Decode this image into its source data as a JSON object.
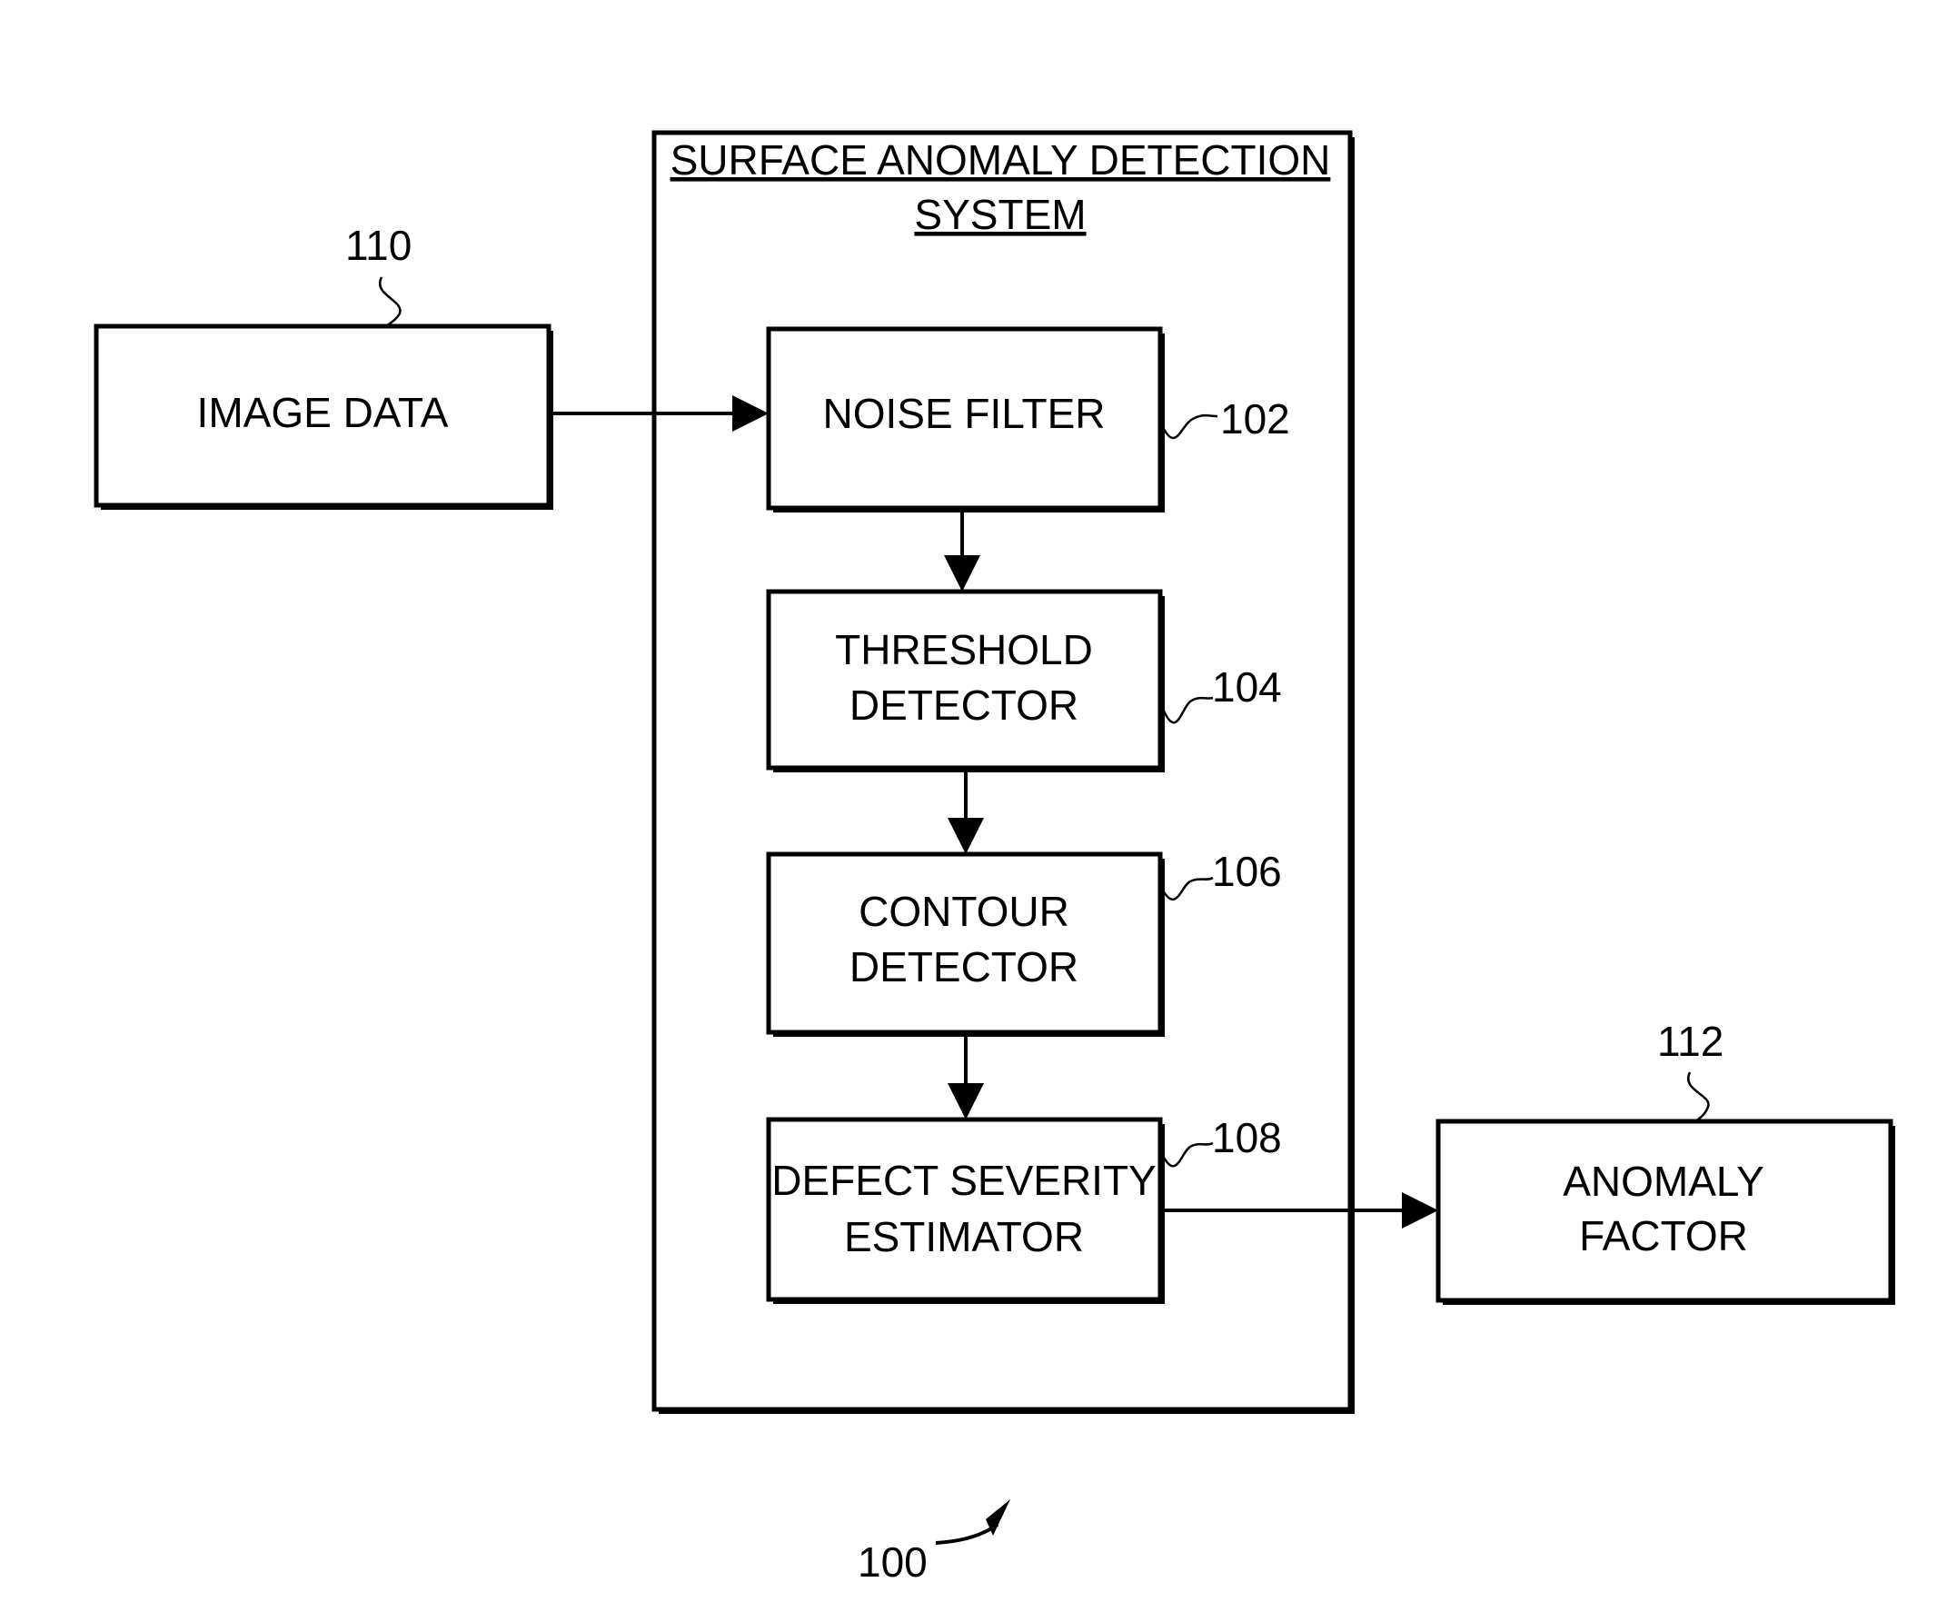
{
  "figure": {
    "figure_ref": "100",
    "system": {
      "title_line1": "SURFACE ANOMALY DETECTION",
      "title_line2": "SYSTEM"
    },
    "input": {
      "label": "IMAGE DATA",
      "ref": "110"
    },
    "components": [
      {
        "id": "noise-filter",
        "line1": "NOISE FILTER",
        "line2": "",
        "ref": "102"
      },
      {
        "id": "threshold-detector",
        "line1": "THRESHOLD",
        "line2": "DETECTOR",
        "ref": "104"
      },
      {
        "id": "contour-detector",
        "line1": "CONTOUR",
        "line2": "DETECTOR",
        "ref": "106"
      },
      {
        "id": "defect-severity-estimator",
        "line1": "DEFECT SEVERITY",
        "line2": "ESTIMATOR",
        "ref": "108"
      }
    ],
    "output": {
      "line1": "ANOMALY",
      "line2": "FACTOR",
      "ref": "112"
    },
    "edges": [
      {
        "from": "image-data",
        "to": "noise-filter"
      },
      {
        "from": "noise-filter",
        "to": "threshold-detector"
      },
      {
        "from": "threshold-detector",
        "to": "contour-detector"
      },
      {
        "from": "contour-detector",
        "to": "defect-severity-estimator"
      },
      {
        "from": "defect-severity-estimator",
        "to": "anomaly-factor"
      }
    ]
  }
}
